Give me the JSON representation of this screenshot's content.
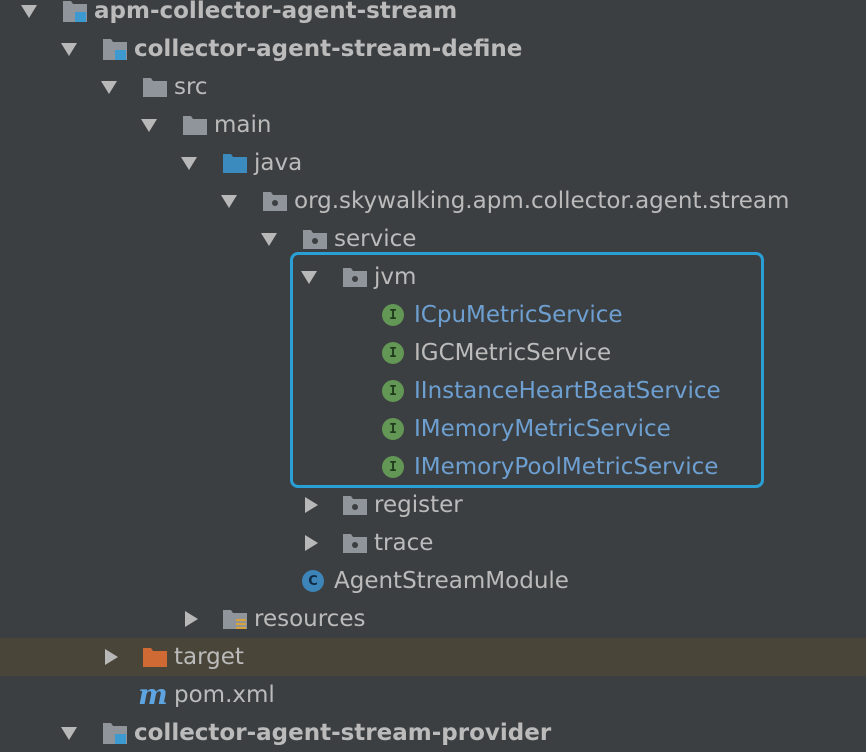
{
  "tree": {
    "rows": [
      {
        "label": "apm-collector-agent-stream",
        "icon": "module-folder-icon"
      },
      {
        "label": "collector-agent-stream-define",
        "icon": "module-folder-icon"
      },
      {
        "label": "src",
        "icon": "folder-icon"
      },
      {
        "label": "main",
        "icon": "folder-icon"
      },
      {
        "label": "java",
        "icon": "source-folder-icon"
      },
      {
        "label": "org.skywalking.apm.collector.agent.stream",
        "icon": "package-icon"
      },
      {
        "label": "service",
        "icon": "package-icon"
      },
      {
        "label": "jvm",
        "icon": "package-icon"
      },
      {
        "label": "ICpuMetricService",
        "icon": "interface-icon",
        "badge": "I"
      },
      {
        "label": "IGCMetricService",
        "icon": "interface-icon",
        "badge": "I"
      },
      {
        "label": "IInstanceHeartBeatService",
        "icon": "interface-icon",
        "badge": "I"
      },
      {
        "label": "IMemoryMetricService",
        "icon": "interface-icon",
        "badge": "I"
      },
      {
        "label": "IMemoryPoolMetricService",
        "icon": "interface-icon",
        "badge": "I"
      },
      {
        "label": "register",
        "icon": "package-icon"
      },
      {
        "label": "trace",
        "icon": "package-icon"
      },
      {
        "label": "AgentStreamModule",
        "icon": "class-icon",
        "badge": "C"
      },
      {
        "label": "resources",
        "icon": "resources-folder-icon"
      },
      {
        "label": "target",
        "icon": "excluded-folder-icon"
      },
      {
        "label": "pom.xml",
        "icon": "maven-icon",
        "badge": "m"
      },
      {
        "label": "collector-agent-stream-provider",
        "icon": "module-folder-icon"
      }
    ]
  },
  "colors": {
    "background": "#3c3f41",
    "text": "#bbbbbb",
    "modified_text": "#6d9fd1",
    "selection": "#4a4539",
    "highlight_border": "#2a9fd6",
    "interface_badge": "#629755",
    "class_badge": "#3d84b8",
    "excluded_folder": "#d06a34"
  }
}
